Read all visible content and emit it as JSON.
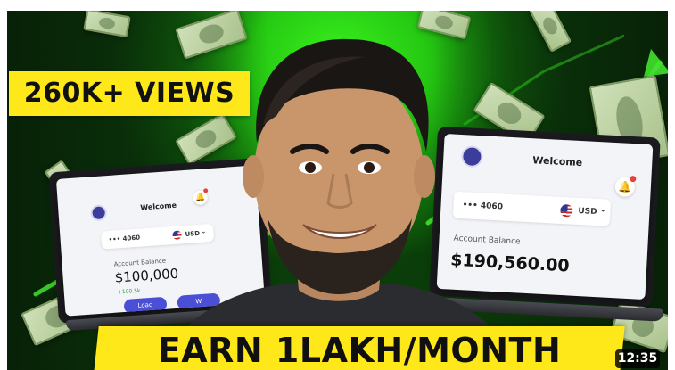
{
  "thumbnail": {
    "views_badge": "260K+ VIEWS",
    "headline": "EARN 1LAKH/MONTH",
    "duration": "12:35",
    "colors": {
      "background_green": "#25c812",
      "banner_yellow": "#ffe81a",
      "button_blue": "#4b4fd6"
    }
  },
  "left_laptop": {
    "title": "Welcome",
    "account": "••• 4060",
    "currency": "USD",
    "balance_label": "Account Balance",
    "balance": "$100,000",
    "delta": "+100.5k",
    "load_button": "Load",
    "second_button": "W"
  },
  "right_laptop": {
    "title": "Welcome",
    "account": "••• 4060",
    "currency": "USD",
    "balance_label": "Account Balance",
    "balance": "$190,560.00"
  },
  "icons": {
    "logo": "infinity-logo-icon",
    "bell": "bell-icon",
    "flag": "us-flag-icon",
    "chevron": "chevron-down-icon"
  }
}
